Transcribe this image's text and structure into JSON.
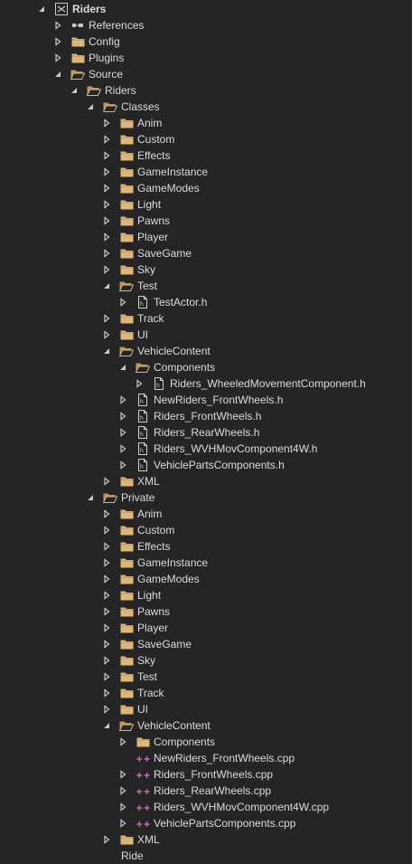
{
  "items": [
    {
      "label": "Riders",
      "depth": 0,
      "icon": "solution-icon",
      "arrow": "expanded"
    },
    {
      "label": "References",
      "depth": 1,
      "icon": "references-icon",
      "arrow": "collapsed"
    },
    {
      "label": "Config",
      "depth": 1,
      "icon": "folder-icon",
      "arrow": "collapsed"
    },
    {
      "label": "Plugins",
      "depth": 1,
      "icon": "folder-icon",
      "arrow": "collapsed"
    },
    {
      "label": "Source",
      "depth": 1,
      "icon": "folder-open-icon",
      "arrow": "expanded"
    },
    {
      "label": "Riders",
      "depth": 2,
      "icon": "folder-open-icon",
      "arrow": "expanded"
    },
    {
      "label": "Classes",
      "depth": 3,
      "icon": "folder-open-icon",
      "arrow": "expanded"
    },
    {
      "label": "Anim",
      "depth": 4,
      "icon": "folder-icon",
      "arrow": "collapsed"
    },
    {
      "label": "Custom",
      "depth": 4,
      "icon": "folder-icon",
      "arrow": "collapsed"
    },
    {
      "label": "Effects",
      "depth": 4,
      "icon": "folder-icon",
      "arrow": "collapsed"
    },
    {
      "label": "GameInstance",
      "depth": 4,
      "icon": "folder-icon",
      "arrow": "collapsed"
    },
    {
      "label": "GameModes",
      "depth": 4,
      "icon": "folder-icon",
      "arrow": "collapsed"
    },
    {
      "label": "Light",
      "depth": 4,
      "icon": "folder-icon",
      "arrow": "collapsed"
    },
    {
      "label": "Pawns",
      "depth": 4,
      "icon": "folder-icon",
      "arrow": "collapsed"
    },
    {
      "label": "Player",
      "depth": 4,
      "icon": "folder-icon",
      "arrow": "collapsed"
    },
    {
      "label": "SaveGame",
      "depth": 4,
      "icon": "folder-icon",
      "arrow": "collapsed"
    },
    {
      "label": "Sky",
      "depth": 4,
      "icon": "folder-icon",
      "arrow": "collapsed"
    },
    {
      "label": "Test",
      "depth": 4,
      "icon": "folder-open-icon",
      "arrow": "expanded"
    },
    {
      "label": "TestActor.h",
      "depth": 5,
      "icon": "header-file-icon",
      "arrow": "collapsed"
    },
    {
      "label": "Track",
      "depth": 4,
      "icon": "folder-icon",
      "arrow": "collapsed"
    },
    {
      "label": "UI",
      "depth": 4,
      "icon": "folder-icon",
      "arrow": "collapsed"
    },
    {
      "label": "VehicleContent",
      "depth": 4,
      "icon": "folder-open-icon",
      "arrow": "expanded"
    },
    {
      "label": "Components",
      "depth": 5,
      "icon": "folder-open-icon",
      "arrow": "expanded"
    },
    {
      "label": "Riders_WheeledMovementComponent.h",
      "depth": 6,
      "icon": "header-file-icon",
      "arrow": "collapsed"
    },
    {
      "label": "NewRiders_FrontWheels.h",
      "depth": 5,
      "icon": "header-file-icon",
      "arrow": "collapsed"
    },
    {
      "label": "Riders_FrontWheels.h",
      "depth": 5,
      "icon": "header-file-icon",
      "arrow": "collapsed"
    },
    {
      "label": "Riders_RearWheels.h",
      "depth": 5,
      "icon": "header-file-icon",
      "arrow": "collapsed"
    },
    {
      "label": "Riders_WVHMovComponent4W.h",
      "depth": 5,
      "icon": "header-file-icon",
      "arrow": "collapsed"
    },
    {
      "label": "VehiclePartsComponents.h",
      "depth": 5,
      "icon": "header-file-icon",
      "arrow": "collapsed"
    },
    {
      "label": "XML",
      "depth": 4,
      "icon": "folder-icon",
      "arrow": "collapsed"
    },
    {
      "label": "Private",
      "depth": 3,
      "icon": "folder-open-icon",
      "arrow": "expanded"
    },
    {
      "label": "Anim",
      "depth": 4,
      "icon": "folder-icon",
      "arrow": "collapsed"
    },
    {
      "label": "Custom",
      "depth": 4,
      "icon": "folder-icon",
      "arrow": "collapsed"
    },
    {
      "label": "Effects",
      "depth": 4,
      "icon": "folder-icon",
      "arrow": "collapsed"
    },
    {
      "label": "GameInstance",
      "depth": 4,
      "icon": "folder-icon",
      "arrow": "collapsed"
    },
    {
      "label": "GameModes",
      "depth": 4,
      "icon": "folder-icon",
      "arrow": "collapsed"
    },
    {
      "label": "Light",
      "depth": 4,
      "icon": "folder-icon",
      "arrow": "collapsed"
    },
    {
      "label": "Pawns",
      "depth": 4,
      "icon": "folder-icon",
      "arrow": "collapsed"
    },
    {
      "label": "Player",
      "depth": 4,
      "icon": "folder-icon",
      "arrow": "collapsed"
    },
    {
      "label": "SaveGame",
      "depth": 4,
      "icon": "folder-icon",
      "arrow": "collapsed"
    },
    {
      "label": "Sky",
      "depth": 4,
      "icon": "folder-icon",
      "arrow": "collapsed"
    },
    {
      "label": "Test",
      "depth": 4,
      "icon": "folder-icon",
      "arrow": "collapsed"
    },
    {
      "label": "Track",
      "depth": 4,
      "icon": "folder-icon",
      "arrow": "collapsed"
    },
    {
      "label": "UI",
      "depth": 4,
      "icon": "folder-icon",
      "arrow": "collapsed"
    },
    {
      "label": "VehicleContent",
      "depth": 4,
      "icon": "folder-open-icon",
      "arrow": "expanded"
    },
    {
      "label": "Components",
      "depth": 5,
      "icon": "folder-icon",
      "arrow": "collapsed"
    },
    {
      "label": "NewRiders_FrontWheels.cpp",
      "depth": 5,
      "icon": "cpp-file-icon",
      "arrow": "none"
    },
    {
      "label": "Riders_FrontWheels.cpp",
      "depth": 5,
      "icon": "cpp-file-icon",
      "arrow": "collapsed"
    },
    {
      "label": "Riders_RearWheels.cpp",
      "depth": 5,
      "icon": "cpp-file-icon",
      "arrow": "collapsed"
    },
    {
      "label": "Riders_WVHMovComponent4W.cpp",
      "depth": 5,
      "icon": "cpp-file-icon",
      "arrow": "collapsed"
    },
    {
      "label": "VehiclePartsComponents.cpp",
      "depth": 5,
      "icon": "cpp-file-icon",
      "arrow": "collapsed"
    },
    {
      "label": "XML",
      "depth": 4,
      "icon": "folder-icon",
      "arrow": "collapsed"
    },
    {
      "label": "Ride",
      "depth": 3,
      "icon": "none",
      "arrow": "none"
    }
  ],
  "colors": {
    "background": "#252526",
    "text": "#dcdcdc",
    "folder": "#dcb67a",
    "folder_dark": "#c09553",
    "arrow": "#c8c8c8",
    "cpp_accent": "#c586c0"
  }
}
